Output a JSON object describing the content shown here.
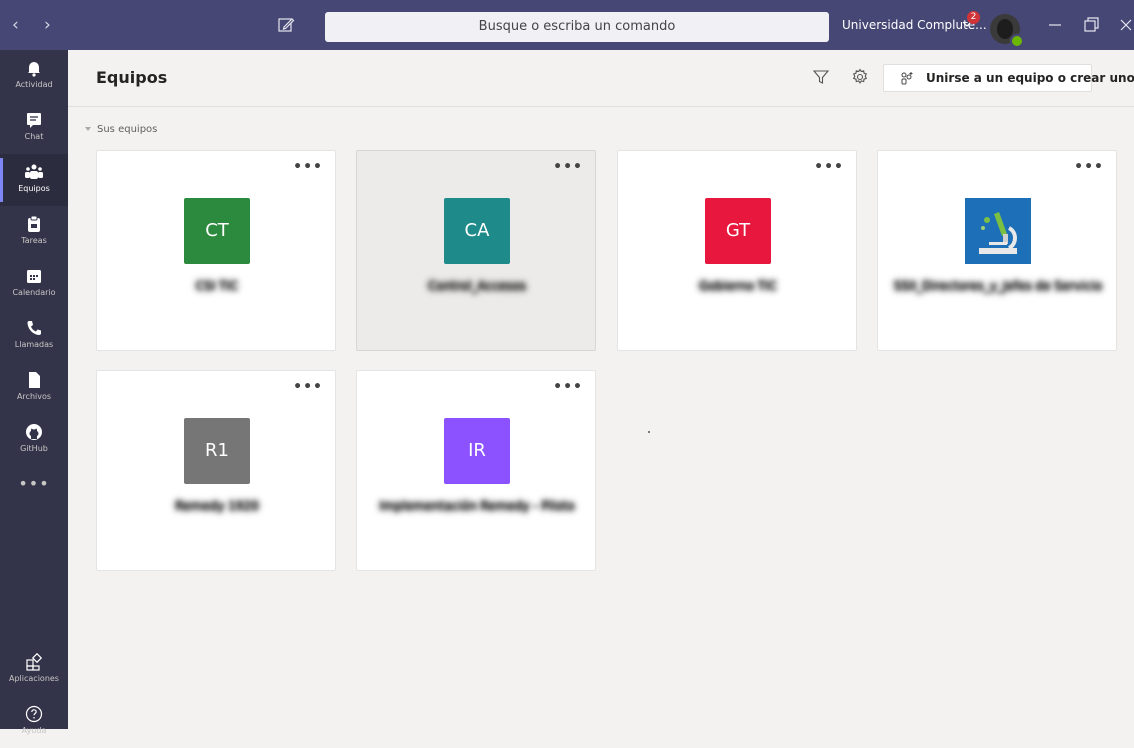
{
  "titlebar": {
    "back_arrow": "‹",
    "forward_arrow": "›",
    "search_placeholder": "Busque o escriba un comando",
    "org_name": "Universidad Complute...",
    "notification_count": "2",
    "icons": [
      "back-icon",
      "forward-icon",
      "compose-icon",
      "chevron-down-icon",
      "avatar",
      "minimize-icon",
      "maximize-icon",
      "close-icon"
    ]
  },
  "rail": {
    "items": [
      {
        "label": "Actividad",
        "icon": "bell-icon"
      },
      {
        "label": "Chat",
        "icon": "chat-icon"
      },
      {
        "label": "Equipos",
        "icon": "teams-icon",
        "active": true
      },
      {
        "label": "Tareas",
        "icon": "assignments-icon"
      },
      {
        "label": "Calendario",
        "icon": "calendar-icon"
      },
      {
        "label": "Llamadas",
        "icon": "phone-icon"
      },
      {
        "label": "Archivos",
        "icon": "files-icon"
      },
      {
        "label": "GitHub",
        "icon": "github-icon"
      }
    ],
    "more": "•••",
    "bottom": [
      {
        "label": "Aplicaciones",
        "icon": "apps-icon"
      },
      {
        "label": "Ayuda",
        "icon": "help-icon"
      }
    ]
  },
  "header": {
    "title": "Equipos",
    "join_button": "Unirse a un equipo o crear uno"
  },
  "section": {
    "label": "Sus equipos"
  },
  "teams": [
    {
      "initials": "CT",
      "color": "#2b8a3e",
      "name": "CSI TIC"
    },
    {
      "initials": "CA",
      "color": "#1f8a8a",
      "name": "Control_Accesos"
    },
    {
      "initials": "GT",
      "color": "#e8173d",
      "name": "Gobierno TIC"
    },
    {
      "initials": "",
      "color": "#1d6fb8",
      "name": "SSII_Directores_y_Jefes de Servicio",
      "icon": "microscope-icon"
    },
    {
      "initials": "R1",
      "color": "#767676",
      "name": "Remedy 1920"
    },
    {
      "initials": "IR",
      "color": "#8c52ff",
      "name": "Implementación Remedy - Piloto"
    }
  ],
  "card_menu": "•••",
  "colors": {
    "titlebar": "#464775",
    "rail": "#33344a",
    "accent": "#7f85f5"
  }
}
